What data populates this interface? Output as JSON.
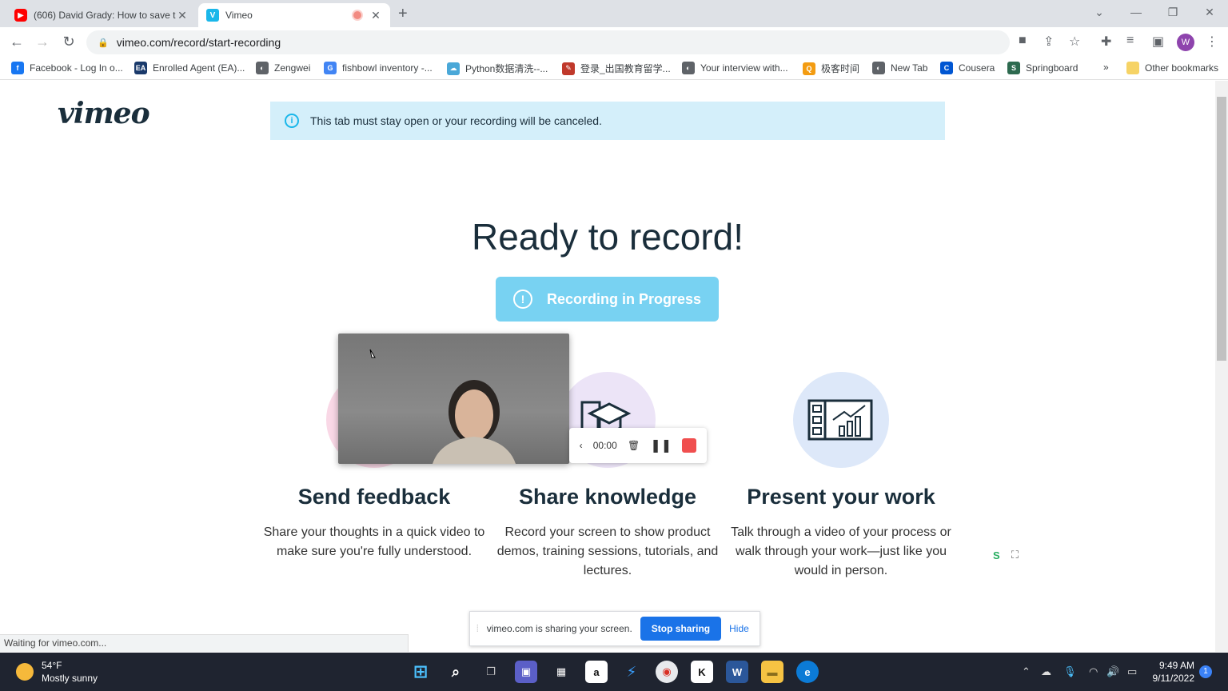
{
  "browser": {
    "tabs": [
      {
        "title": "(606) David Grady: How to save t",
        "favicon": "youtube-icon"
      },
      {
        "title": "Vimeo",
        "favicon": "vimeo-icon"
      }
    ],
    "url": "vimeo.com/record/start-recording",
    "profile_initial": "W",
    "bookmarks": [
      {
        "label": "Facebook - Log In o...",
        "color": "#1877f2",
        "glyph": "f"
      },
      {
        "label": "Enrolled Agent (EA)...",
        "color": "#1a3a6b",
        "glyph": "EA"
      },
      {
        "label": "Zengwei",
        "color": "#5f6368",
        "glyph": "◐"
      },
      {
        "label": "fishbowl inventory -...",
        "color": "#4285f4",
        "glyph": "G"
      },
      {
        "label": "Python数据清洗--...",
        "color": "#4aa8d8",
        "glyph": "☁"
      },
      {
        "label": "登录_出国教育留学...",
        "color": "#c0392b",
        "glyph": "✎"
      },
      {
        "label": "Your interview with...",
        "color": "#5f6368",
        "glyph": "◐"
      },
      {
        "label": "极客时间",
        "color": "#f39c12",
        "glyph": "Q"
      },
      {
        "label": "New Tab",
        "color": "#5f6368",
        "glyph": "◐"
      },
      {
        "label": "Cousera",
        "color": "#0056d2",
        "glyph": "C"
      },
      {
        "label": "Springboard",
        "color": "#2d6a4f",
        "glyph": "S"
      }
    ],
    "bookmarks_overflow": "»",
    "other_bookmarks": "Other bookmarks",
    "status_text": "Waiting for vimeo.com..."
  },
  "page": {
    "logo": "vimeo",
    "banner": "This tab must stay open or your recording will be canceled.",
    "headline": "Ready to record!",
    "record_button": "Recording in Progress",
    "features": [
      {
        "title": "Send feedback",
        "desc": "Share your thoughts in a quick video to make sure you're fully understood.",
        "color": "#f9d8e6"
      },
      {
        "title": "Share knowledge",
        "desc": "Record your screen to show product demos, training sessions, tutorials, and lectures.",
        "color": "#ece4f7"
      },
      {
        "title": "Present your work",
        "desc": "Talk through a video of your process or walk through your work—just like you would in person.",
        "color": "#dde8f9"
      }
    ],
    "recorder_time": "00:00"
  },
  "share_bar": {
    "message": "vimeo.com is sharing your screen.",
    "stop_label": "Stop sharing",
    "hide_label": "Hide"
  },
  "taskbar": {
    "weather_temp": "54°F",
    "weather_desc": "Mostly sunny",
    "time": "9:49 AM",
    "date": "9/11/2022",
    "notification_count": "1"
  }
}
